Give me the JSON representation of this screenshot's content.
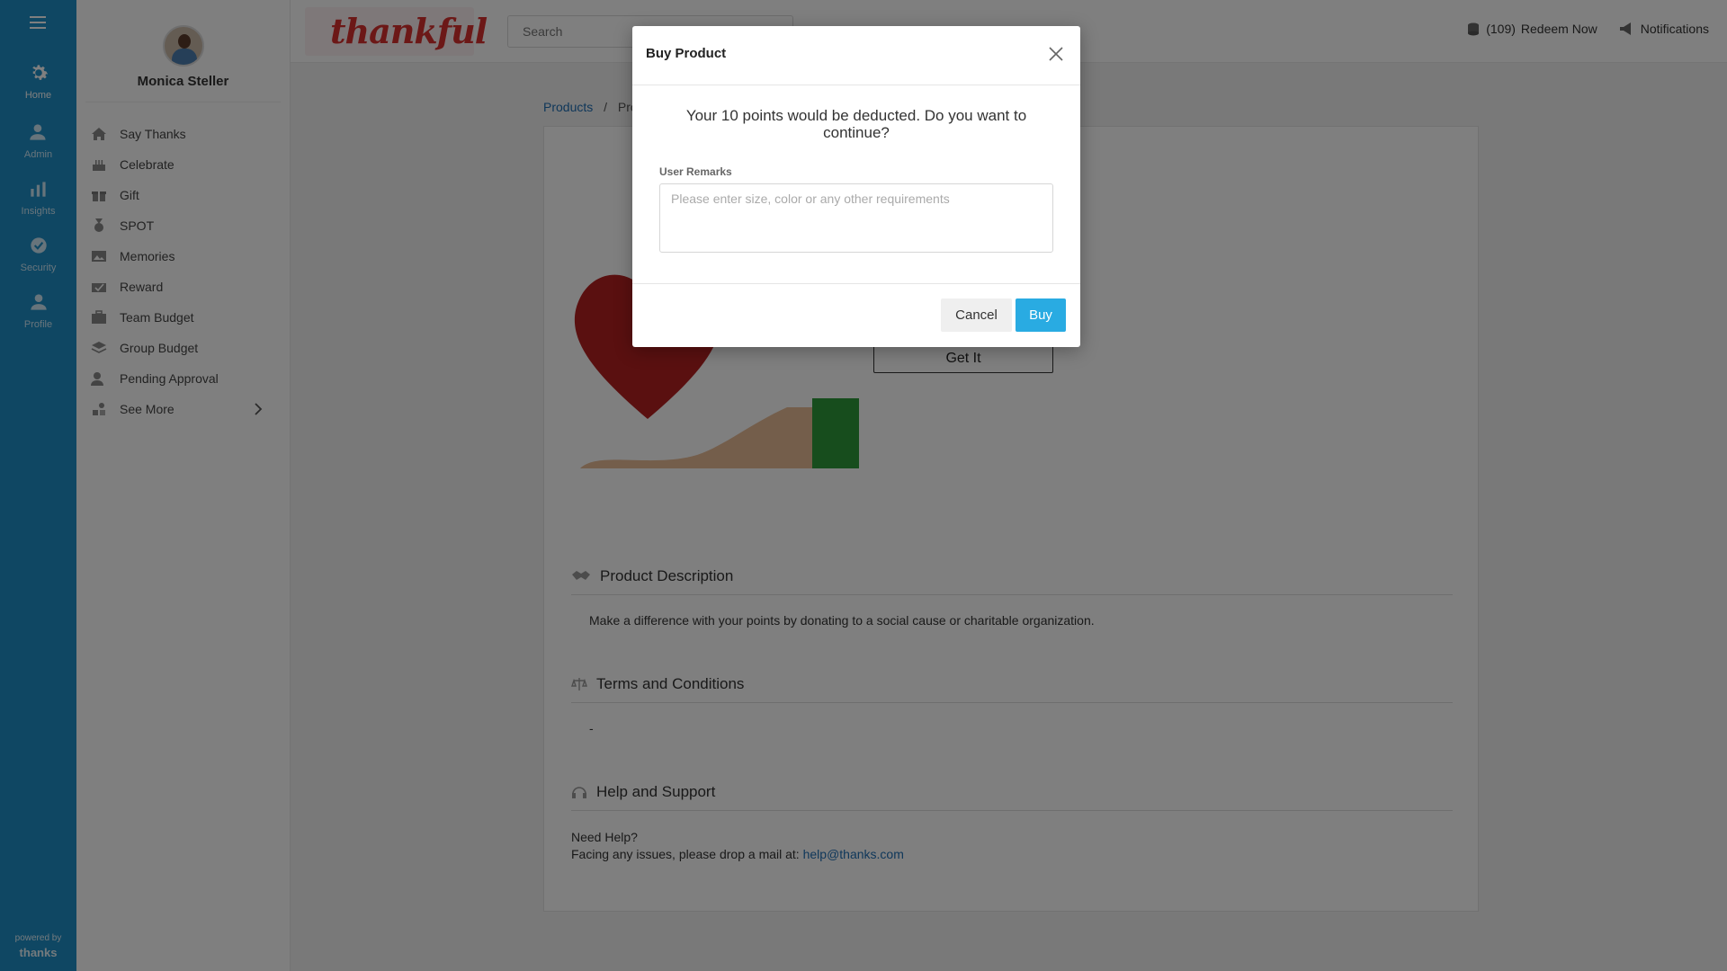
{
  "user": {
    "name": "Monica Steller"
  },
  "rail": {
    "items": [
      {
        "label": "Home",
        "icon": "gear-icon"
      },
      {
        "label": "Admin",
        "icon": "admin-user-icon"
      },
      {
        "label": "Insights",
        "icon": "bar-chart-icon"
      },
      {
        "label": "Security",
        "icon": "shield-check-icon"
      },
      {
        "label": "Profile",
        "icon": "person-icon"
      }
    ],
    "powered_by": "powered by",
    "brand": "thanks"
  },
  "sidebar": {
    "items": [
      {
        "label": "Say Thanks",
        "icon": "house-icon"
      },
      {
        "label": "Celebrate",
        "icon": "cake-icon"
      },
      {
        "label": "Gift",
        "icon": "gift-icon"
      },
      {
        "label": "SPOT",
        "icon": "medal-icon"
      },
      {
        "label": "Memories",
        "icon": "photo-icon"
      },
      {
        "label": "Reward",
        "icon": "reward-icon"
      },
      {
        "label": "Team Budget",
        "icon": "briefcase-icon"
      },
      {
        "label": "Group Budget",
        "icon": "layers-icon"
      },
      {
        "label": "Pending Approval",
        "icon": "user-clock-icon"
      },
      {
        "label": "See More",
        "icon": "shapes-icon"
      }
    ]
  },
  "header": {
    "logo_text": "thankful",
    "search_placeholder": "Search",
    "points": "(109)",
    "redeem_label": "Redeem Now",
    "notifications_label": "Notifications"
  },
  "breadcrumb": {
    "root": "Products",
    "separator": "/",
    "current": "Pro"
  },
  "product": {
    "cta": "Get It",
    "description_title": "Product Description",
    "description": "Make a difference with your points by donating to a social cause or charitable organization.",
    "terms_title": "Terms and Conditions",
    "terms": "-",
    "help_title": "Help and Support",
    "help_line1": "Need Help?",
    "help_line2": "Facing any issues, please drop a mail at:",
    "help_email": "help@thanks.com"
  },
  "modal": {
    "title": "Buy Product",
    "message": "Your 10 points would be deducted. Do you want to continue?",
    "remarks_label": "User Remarks",
    "remarks_placeholder": "Please enter size, color or any other requirements",
    "remarks_value": "",
    "cancel_label": "Cancel",
    "buy_label": "Buy"
  },
  "colors": {
    "rail": "#1f8fc7",
    "link": "#1f6fb5",
    "buy_button": "#29abe2",
    "logo": "#d9302f"
  }
}
